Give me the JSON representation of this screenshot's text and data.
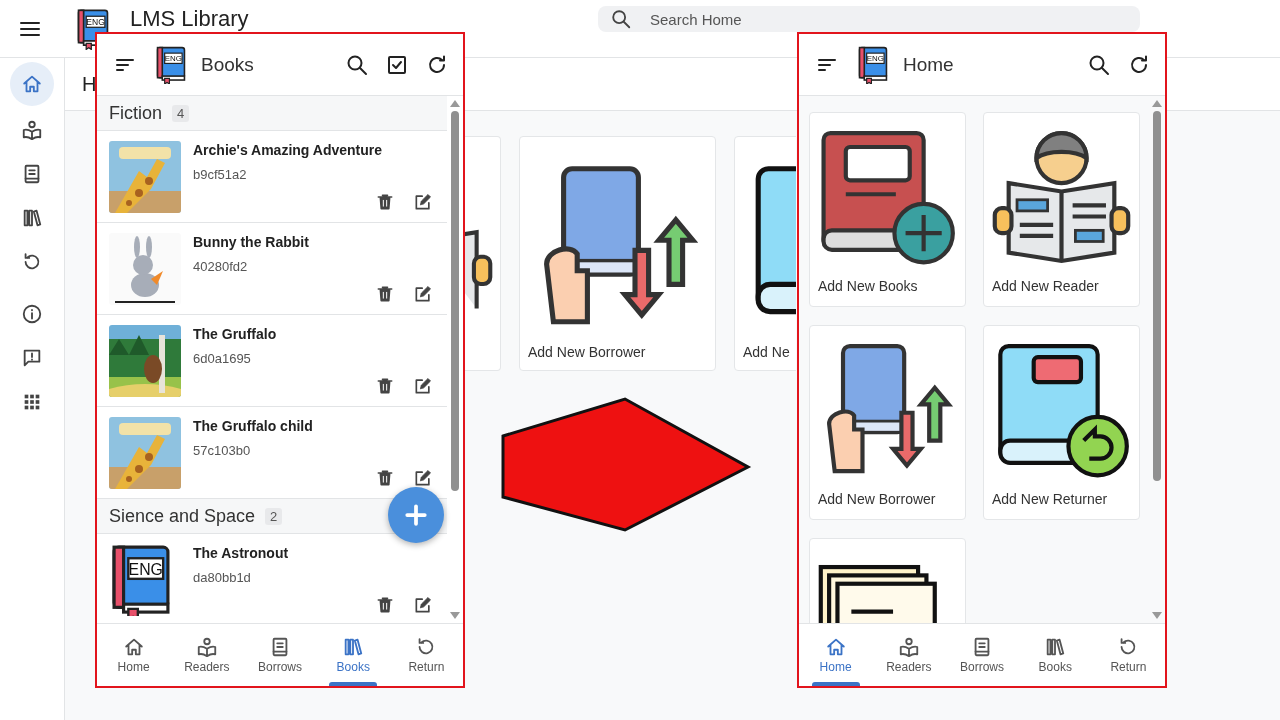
{
  "app": {
    "logo_text": "ENG",
    "title": "LMS Library",
    "search": {
      "placeholder": "Search Home"
    },
    "nav_rail": [
      {
        "selected": true
      },
      {
        "selected": false
      },
      {
        "selected": false
      },
      {
        "selected": false
      },
      {
        "selected": false
      },
      {
        "selected": false
      },
      {
        "selected": false
      },
      {
        "selected": false
      }
    ],
    "heading": "H",
    "cards": [
      {
        "kind": "reader"
      },
      {
        "kind": "borrow",
        "label": "Add New Borrower"
      },
      {
        "kind": "return",
        "label": "Add Ne"
      }
    ]
  },
  "books_screen": {
    "logo_text": "ENG",
    "title": "Books",
    "actions": [
      {
        "kind": "search"
      },
      {
        "kind": "select"
      },
      {
        "kind": "refresh"
      }
    ],
    "groups": [
      {
        "name": "Fiction",
        "count": "4",
        "books": [
          {
            "title": "Archie's Amazing Adventure",
            "code": "b9cf51a2"
          },
          {
            "title": "Bunny the Rabbit",
            "code": "40280fd2"
          },
          {
            "title": "The Gruffalo",
            "code": "6d0a1695"
          },
          {
            "title": "The Gruffalo child",
            "code": "57c103b0"
          }
        ]
      },
      {
        "name": "Sience and Space",
        "count": "2",
        "books": [
          {
            "title": "The Astronout",
            "code": "da80bb1d",
            "cover": {
              "kind": "logo",
              "text": "ENG"
            }
          }
        ]
      }
    ],
    "bottom_nav": [
      {
        "label": "Home",
        "selected": false
      },
      {
        "label": "Readers",
        "selected": false
      },
      {
        "label": "Borrows",
        "selected": false
      },
      {
        "label": "Books",
        "selected": true
      },
      {
        "label": "Return",
        "selected": false
      }
    ]
  },
  "home_screen": {
    "logo_text": "ENG",
    "title": "Home",
    "actions": [
      {
        "kind": "search"
      },
      {
        "kind": "refresh"
      }
    ],
    "tiles": [
      {
        "kind": "add-book",
        "label": "Add New Books"
      },
      {
        "kind": "reader",
        "label": "Add New Reader"
      },
      {
        "kind": "borrow",
        "label": "Add New Borrower"
      },
      {
        "kind": "return",
        "label": "Add New Returner"
      },
      {
        "kind": "report"
      }
    ],
    "bottom_nav": [
      {
        "label": "Home",
        "selected": true
      },
      {
        "label": "Readers",
        "selected": false
      },
      {
        "label": "Borrows",
        "selected": false
      },
      {
        "label": "Books",
        "selected": false
      },
      {
        "label": "Return",
        "selected": false
      }
    ]
  }
}
